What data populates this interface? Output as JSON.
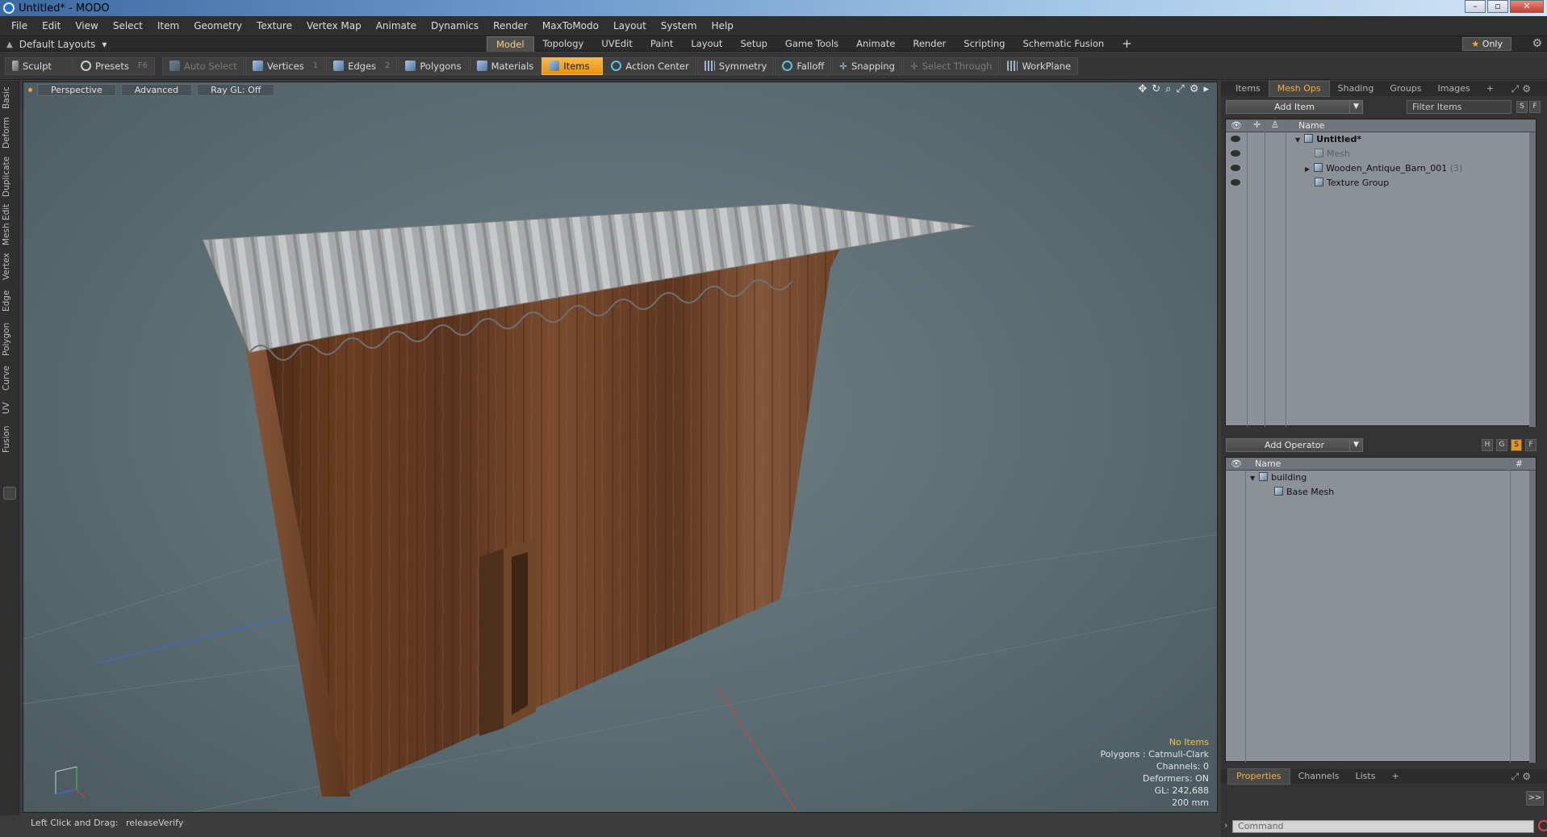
{
  "window": {
    "title": "Untitled* - MODO",
    "minimize": "–",
    "maximize": "▫",
    "close": "✕"
  },
  "menu": [
    "File",
    "Edit",
    "View",
    "Select",
    "Item",
    "Geometry",
    "Texture",
    "Vertex Map",
    "Animate",
    "Dynamics",
    "Render",
    "MaxToModo",
    "Layout",
    "System",
    "Help"
  ],
  "layout_picker": {
    "label": "Default Layouts",
    "caret": "▾"
  },
  "layout_tabs": [
    {
      "label": "Model",
      "active": true
    },
    {
      "label": "Topology"
    },
    {
      "label": "UVEdit"
    },
    {
      "label": "Paint"
    },
    {
      "label": "Layout"
    },
    {
      "label": "Setup"
    },
    {
      "label": "Game Tools"
    },
    {
      "label": "Animate"
    },
    {
      "label": "Render"
    },
    {
      "label": "Scripting"
    },
    {
      "label": "Schematic Fusion"
    }
  ],
  "layout_add": "+",
  "only_button": {
    "star": "★",
    "label": "Only"
  },
  "toolbar": {
    "sculpt": "Sculpt",
    "presets": "Presets",
    "presets_key": "F6",
    "auto_select": "Auto Select",
    "vertices": "Vertices",
    "vertices_key": "1",
    "edges": "Edges",
    "edges_key": "2",
    "polygons": "Polygons",
    "materials": "Materials",
    "items": "Items",
    "action_center": "Action Center",
    "symmetry": "Symmetry",
    "falloff": "Falloff",
    "snapping": "Snapping",
    "select_through": "Select Through",
    "workplane": "WorkPlane"
  },
  "left_tabs": [
    "Basic",
    "Deform",
    "Duplicate",
    "Mesh Edit",
    "Vertex",
    "Edge",
    "Polygon",
    "Curve",
    "UV",
    "Fusion"
  ],
  "viewport": {
    "view_mode": "Perspective",
    "shading": "Advanced",
    "raygl": "Ray GL: Off",
    "info": {
      "items": "No Items",
      "polygons": "Polygons : Catmull-Clark",
      "channels": "Channels: 0",
      "deformers": "Deformers: ON",
      "gl": "GL: 242,688",
      "grid": "200 mm"
    }
  },
  "status": {
    "hint": "Left Click and Drag:",
    "action": "releaseVerify"
  },
  "items_panel": {
    "tabs": [
      {
        "label": "Items"
      },
      {
        "label": "Mesh Ops",
        "active": true
      },
      {
        "label": "Shading"
      },
      {
        "label": "Groups"
      },
      {
        "label": "Images"
      },
      {
        "label": "+"
      }
    ],
    "add_item": "Add Item",
    "filter": "Filter Items",
    "btn_s": "S",
    "btn_f": "F",
    "col_name": "Name",
    "rows": [
      {
        "label": "Untitled*",
        "count": ""
      },
      {
        "label": "Mesh",
        "count": ""
      },
      {
        "label": "Wooden_Antique_Barn_001",
        "count": "(3)"
      },
      {
        "label": "Texture Group",
        "count": ""
      }
    ]
  },
  "meshops_panel": {
    "add_operator": "Add Operator",
    "btns": [
      "H",
      "G",
      "S",
      "F"
    ],
    "col_name": "Name",
    "col_hash": "#",
    "rows": [
      {
        "label": "building"
      },
      {
        "label": "Base Mesh"
      }
    ]
  },
  "props_panel": {
    "tabs": [
      {
        "label": "Properties",
        "active": true
      },
      {
        "label": "Channels"
      },
      {
        "label": "Lists"
      },
      {
        "label": "+"
      }
    ],
    "expand": ">>",
    "command_placeholder": "Command"
  },
  "colors": {
    "accent": "#f2b13a",
    "viewport": "#5b6c73",
    "active_tool": "#e8920f"
  }
}
